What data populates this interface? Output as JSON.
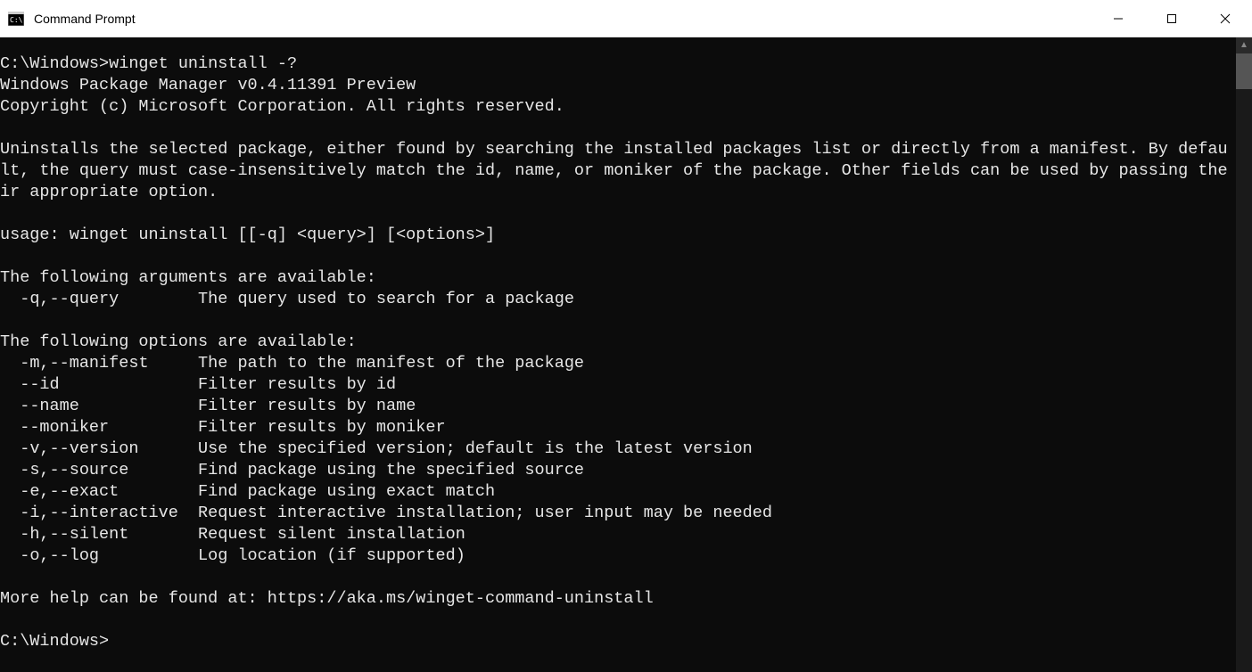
{
  "window": {
    "title": "Command Prompt"
  },
  "terminal": {
    "prompt1": "C:\\Windows>",
    "command1": "winget uninstall -?",
    "version_line": "Windows Package Manager v0.4.11391 Preview",
    "copyright_line": "Copyright (c) Microsoft Corporation. All rights reserved.",
    "description": "Uninstalls the selected package, either found by searching the installed packages list or directly from a manifest. By default, the query must case-insensitively match the id, name, or moniker of the package. Other fields can be used by passing their appropriate option.",
    "usage_line": "usage: winget uninstall [[-q] <query>] [<options>]",
    "args_header": "The following arguments are available:",
    "args": [
      {
        "flag": "  -q,--query",
        "desc": "The query used to search for a package"
      }
    ],
    "options_header": "The following options are available:",
    "options": [
      {
        "flag": "  -m,--manifest",
        "desc": "The path to the manifest of the package"
      },
      {
        "flag": "  --id",
        "desc": "Filter results by id"
      },
      {
        "flag": "  --name",
        "desc": "Filter results by name"
      },
      {
        "flag": "  --moniker",
        "desc": "Filter results by moniker"
      },
      {
        "flag": "  -v,--version",
        "desc": "Use the specified version; default is the latest version"
      },
      {
        "flag": "  -s,--source",
        "desc": "Find package using the specified source"
      },
      {
        "flag": "  -e,--exact",
        "desc": "Find package using exact match"
      },
      {
        "flag": "  -i,--interactive",
        "desc": "Request interactive installation; user input may be needed"
      },
      {
        "flag": "  -h,--silent",
        "desc": "Request silent installation"
      },
      {
        "flag": "  -o,--log",
        "desc": "Log location (if supported)"
      }
    ],
    "more_help_prefix": "More help can be found at: ",
    "more_help_url": "https://aka.ms/winget-command-uninstall",
    "prompt2": "C:\\Windows>"
  }
}
